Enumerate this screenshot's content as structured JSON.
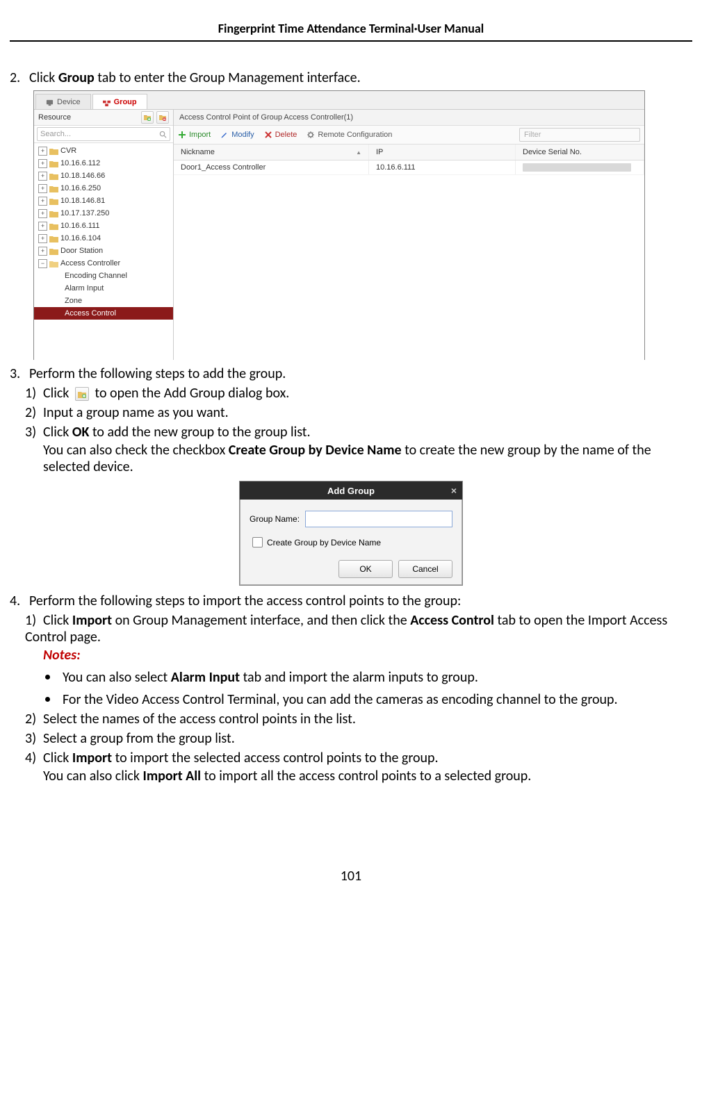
{
  "header": "Fingerprint Time Attendance Terminal·User Manual",
  "page_number": "101",
  "step2": {
    "num": "2.",
    "prefix": "Click ",
    "bold": "Group",
    "suffix": " tab to enter the Group Management interface."
  },
  "shot1": {
    "tab_device": "Device",
    "tab_group": "Group",
    "resource_label": "Resource",
    "search_placeholder": "Search...",
    "tree": [
      "CVR",
      "10.16.6.112",
      "10.18.146.66",
      "10.16.6.250",
      "10.18.146.81",
      "10.17.137.250",
      "10.16.6.111",
      "10.16.6.104",
      "Door Station"
    ],
    "tree_access_controller": "Access Controller",
    "tree_children": [
      "Encoding Channel",
      "Alarm Input",
      "Zone",
      "Access Control"
    ],
    "right_title": "Access Control Point of Group Access Controller(1)",
    "tb_import": "Import",
    "tb_modify": "Modify",
    "tb_delete": "Delete",
    "tb_remote": "Remote Configuration",
    "tb_filter": "Filter",
    "col_nickname": "Nickname",
    "col_ip": "IP",
    "col_serial": "Device Serial No.",
    "row_nickname": "Door1_Access Controller",
    "row_ip": "10.16.6.111"
  },
  "step3": {
    "num": "3.",
    "text": "Perform the following steps to add the group.",
    "sub1_num": "1)",
    "sub1_a": "Click ",
    "sub1_b": " to open the Add Group dialog box.",
    "sub2_num": "2)",
    "sub2": "Input a group name as you want.",
    "sub3_num": "3)",
    "sub3_a": "Click ",
    "sub3_bold": "OK",
    "sub3_b": " to add the new group to the group list.",
    "sub3_line2a": "You can also check the checkbox ",
    "sub3_line2bold": "Create Group by Device Name",
    "sub3_line2b": " to create the new group by the name of the selected device."
  },
  "shot2": {
    "title": "Add Group",
    "label": "Group Name:",
    "checkbox": "Create Group by Device Name",
    "ok": "OK",
    "cancel": "Cancel"
  },
  "step4": {
    "num": "4.",
    "text": "Perform the following steps to import the access control points to the group:",
    "s1_num": "1)",
    "s1_a": "Click ",
    "s1_b1": "Import",
    "s1_c": " on Group Management interface, and then click the ",
    "s1_b2": "Access Control",
    "s1_d": " tab to open the Import Access Control page.",
    "notes": "Notes:",
    "bullet1a": "You can also select ",
    "bullet1b": "Alarm Input",
    "bullet1c": " tab and import the alarm inputs to group.",
    "bullet2": "For the Video Access Control Terminal, you can add the cameras as encoding channel to the group.",
    "s2_num": "2)",
    "s2": "Select the names of the access control points in the list.",
    "s3_num": "3)",
    "s3": "Select a group from the group list.",
    "s4_num": "4)",
    "s4_a": "Click ",
    "s4_b1": "Import",
    "s4_c": " to import the selected access control points to the group.",
    "s4_line2a": "You can also click ",
    "s4_line2b": "Import All",
    "s4_line2c": " to import all the access control points to a selected group."
  }
}
